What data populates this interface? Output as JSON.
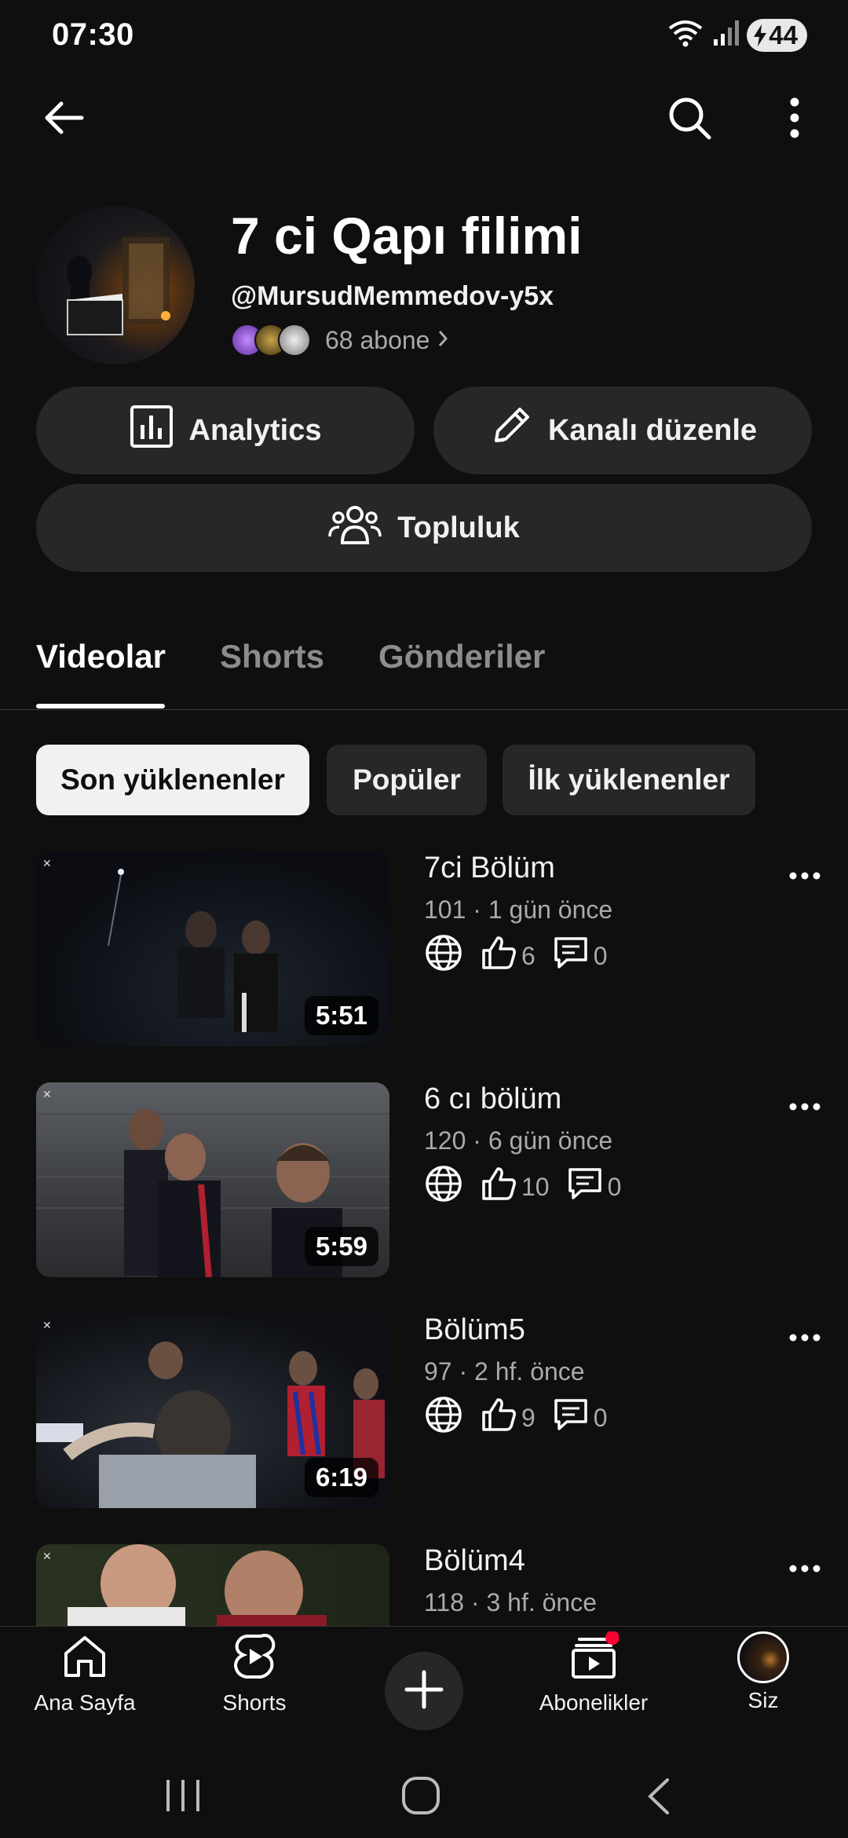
{
  "status_bar": {
    "time": "07:30",
    "battery": "44",
    "icons": [
      "wifi-icon",
      "signal-icon",
      "battery-charging-icon"
    ]
  },
  "top_bar": {
    "icons": [
      "back-arrow-icon",
      "search-icon",
      "more-vert-icon"
    ]
  },
  "channel": {
    "title": "7 ci Qapı filimi",
    "handle": "@MursudMemmedov-y5x",
    "subscribers": "68 abone"
  },
  "actions": {
    "analytics": "Analytics",
    "edit_channel": "Kanalı düzenle",
    "community": "Topluluk"
  },
  "tabs": [
    "Videolar",
    "Shorts",
    "Gönderiler"
  ],
  "active_tab": "Videolar",
  "filters": [
    "Son yüklenenler",
    "Popüler",
    "İlk yüklenenler"
  ],
  "selected_filter": "Son yüklenenler",
  "videos": [
    {
      "title": "7ci Bölüm",
      "meta": "101 · 1 gün önce",
      "likes": "6",
      "comments": "0",
      "duration": "5:51"
    },
    {
      "title": "6 cı bölüm",
      "meta": "120 · 6 gün önce",
      "likes": "10",
      "comments": "0",
      "duration": "5:59"
    },
    {
      "title": "Bölüm5",
      "meta": "97 · 2 hf. önce",
      "likes": "9",
      "comments": "0",
      "duration": "6:19"
    },
    {
      "title": "Bölüm4",
      "meta": "118 · 3 hf. önce"
    }
  ],
  "bottom_nav": {
    "home": "Ana Sayfa",
    "shorts": "Shorts",
    "subscriptions": "Abonelikler",
    "you": "Siz"
  },
  "colors": {
    "background": "#0f0f0f",
    "surface": "#272727",
    "secondary_text": "#aaaaaa",
    "notification_dot": "#ff0033"
  }
}
